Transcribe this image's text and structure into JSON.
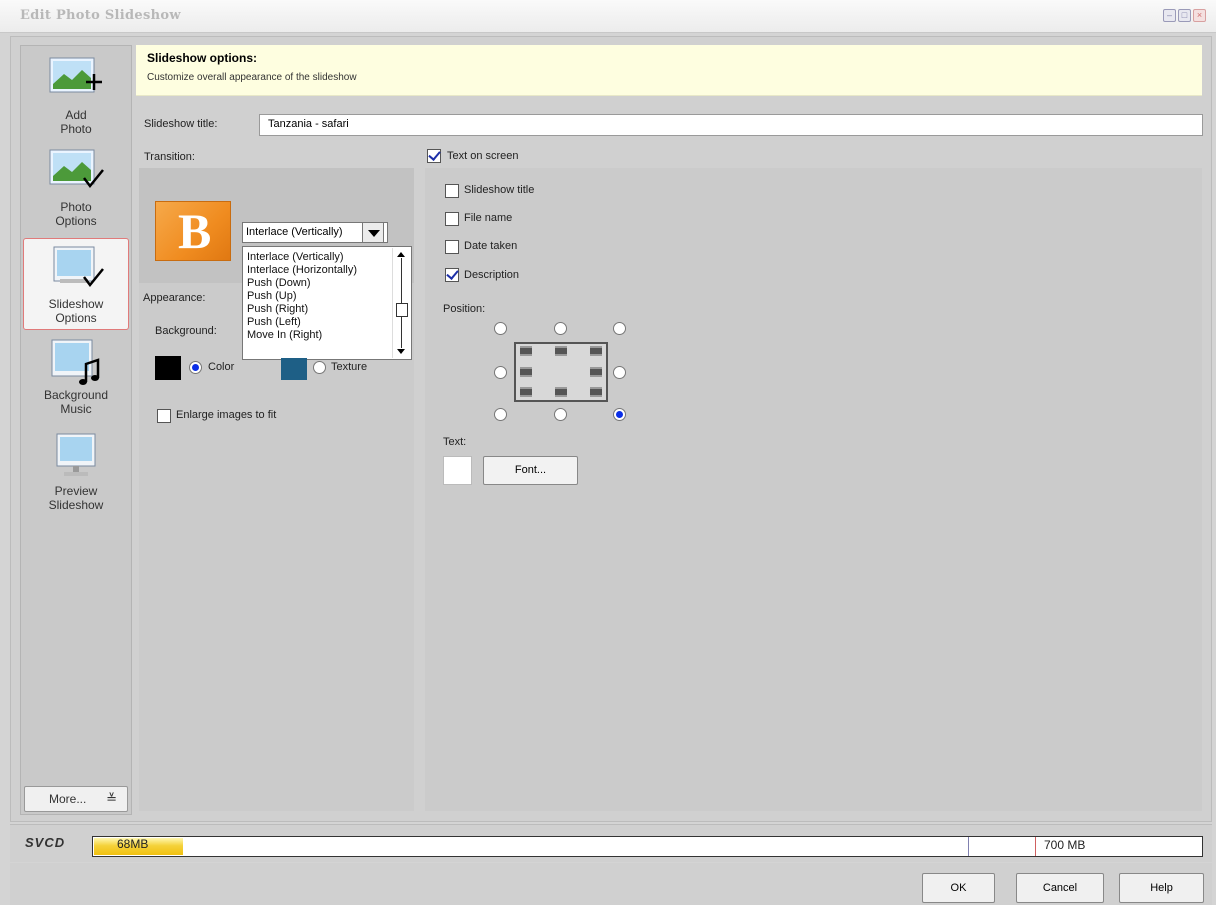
{
  "window": {
    "title": "Edit Photo Slideshow"
  },
  "sidebar": {
    "items": [
      {
        "label": "Add Photo",
        "icon": "add-photo-icon"
      },
      {
        "label": "Photo Options",
        "icon": "photo-options-icon"
      },
      {
        "label": "Slideshow Options",
        "icon": "slideshow-options-icon",
        "active": true
      },
      {
        "label": "Background Music",
        "icon": "background-music-icon"
      },
      {
        "label": "Preview Slideshow",
        "icon": "preview-slideshow-icon"
      }
    ],
    "more_label": "More...",
    "more_icon": "double-chevron-down-icon"
  },
  "banner": {
    "heading": "Slideshow options:",
    "subtitle": "Customize overall appearance of the slideshow"
  },
  "form": {
    "title_label": "Slideshow title:",
    "title_value": "Tanzania - safari",
    "transition_label": "Transition:",
    "transition_icon_letter": "B",
    "transition_selected": "Interlace (Vertically)",
    "transition_options": [
      "Interlace (Vertically)",
      "Interlace (Horizontally)",
      "Push (Down)",
      "Push (Up)",
      "Push (Right)",
      "Push (Left)",
      "Move In (Right)"
    ],
    "appearance_label": "Appearance:",
    "background_label": "Background:",
    "color_option": "Color",
    "texture_option": "Texture",
    "background_mode": "Color",
    "color_swatch": "#000000",
    "texture_swatch": "#1e5f86",
    "enlarge_label": "Enlarge images to fit",
    "enlarge_checked": false
  },
  "text_on_screen": {
    "label": "Text on screen",
    "checked": true,
    "options": [
      {
        "label": "Slideshow title",
        "checked": false
      },
      {
        "label": "File name",
        "checked": false
      },
      {
        "label": "Date taken",
        "checked": false
      },
      {
        "label": "Description",
        "checked": true
      }
    ],
    "position_label": "Position:",
    "selected_position": "bottom-right",
    "text_label": "Text:",
    "text_color": "#ffffff",
    "font_button": "Font..."
  },
  "disc": {
    "format": "SVCD",
    "used_label": "68MB",
    "capacity_label": "700 MB",
    "used_fraction": 0.08
  },
  "footer": {
    "ok": "OK",
    "cancel": "Cancel",
    "help": "Help"
  },
  "colors": {
    "banner_bg": "#fefee0",
    "active_border": "#e07a7a",
    "radio_selected": "#0a2ee8",
    "disc_fill": "#f5d23a"
  }
}
